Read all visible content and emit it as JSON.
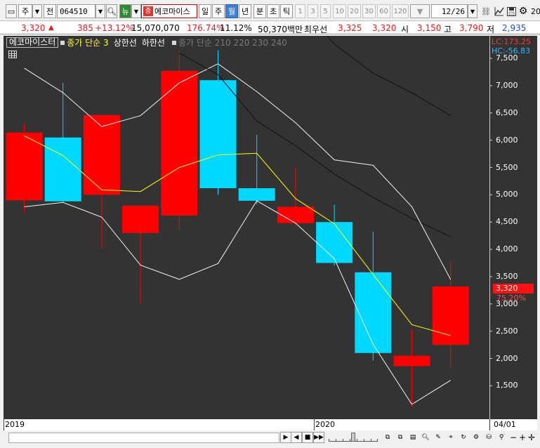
{
  "toolbar": {
    "period_main": "주",
    "jeon": "전",
    "code": "064510",
    "nyu": "뉴",
    "badge": "증",
    "stock_name": "에코마이스",
    "periods": [
      "일",
      "주",
      "월",
      "년",
      "분",
      "초",
      "틱"
    ],
    "selected_period": "월",
    "numbers": [
      "1",
      "3",
      "5",
      "10",
      "20",
      "30",
      "60",
      "120"
    ],
    "page": "12/26",
    "edge": "20"
  },
  "quote": {
    "price": "3,320",
    "change": "385",
    "change_pct": "+13.12%",
    "volume": "15,070,070",
    "vol_ratio": "176.74%",
    "turnover": "11.12%",
    "amount": "50,370백만",
    "best_ask_label": "최우선",
    "best_ask": "3,325",
    "best_bid": "3,320",
    "open_label": "시",
    "open": "3,150",
    "high_label": "고",
    "high": "3,790",
    "low_label": "저",
    "low": "2,935"
  },
  "legend": {
    "name": "에코마이스터",
    "ma": "종가 단순 3",
    "upper": "상한선",
    "lower": "하한선",
    "vol_ma": "종가 단순 210  220  230  240"
  },
  "axis": {
    "lc": "LC:173.25",
    "hc": "HC:-56.83",
    "current_price": "3,320",
    "current_pct": "75.20%"
  },
  "chart_data": {
    "type": "candlestick",
    "x": [
      "2019-01",
      "2019-02",
      "2019-03",
      "2019-04",
      "2019-05",
      "2019-06",
      "2019-07",
      "2019-08",
      "2019-09",
      "2019-10",
      "2019-11",
      "2019-12"
    ],
    "open": [
      4900,
      6050,
      5000,
      4300,
      4620,
      7100,
      5120,
      4480,
      4500,
      3580,
      1860,
      2250
    ],
    "high": [
      6300,
      7050,
      6420,
      4800,
      7650,
      7650,
      6100,
      5500,
      4820,
      4320,
      2530,
      3790
    ],
    "low": [
      4680,
      4850,
      4020,
      3000,
      4350,
      5000,
      4830,
      4430,
      3700,
      1960,
      1120,
      1830
    ],
    "close": [
      6140,
      4880,
      6460,
      4800,
      7270,
      5120,
      4890,
      4780,
      3750,
      2100,
      2050,
      3320
    ],
    "up_color": "#ff0000",
    "down_color": "#00d8ff",
    "ma3": [
      6080,
      5720,
      5090,
      5060,
      5500,
      5730,
      5760,
      4930,
      4470,
      3540,
      2620,
      2420
    ],
    "upper_band": [
      7320,
      6870,
      6250,
      6450,
      7050,
      7400,
      6890,
      6320,
      5640,
      5540,
      4780,
      3450
    ],
    "lower_band": [
      4780,
      4860,
      4590,
      3710,
      3450,
      3740,
      4890,
      4480,
      3830,
      2260,
      1160,
      1600
    ],
    "long_ma_a": [
      null,
      null,
      null,
      null,
      null,
      null,
      null,
      null,
      7760,
      7230,
      6870,
      6450
    ],
    "long_ma_b": [
      null,
      null,
      null,
      null,
      null,
      null,
      6350,
      5900,
      5380,
      4950,
      4570,
      4230
    ],
    "ylim": [
      900,
      7900
    ],
    "y_ticks": [
      1500,
      2000,
      2500,
      3000,
      3500,
      4000,
      4500,
      5000,
      5500,
      6000,
      6500,
      7000,
      7500
    ],
    "y_tick_labels": [
      "1,500",
      "2,000",
      "2,500",
      "3,000",
      "3,500",
      "4,000",
      "4,500",
      "5,000",
      "5,500",
      "6,000",
      "6,500",
      "7,000",
      "7,500"
    ],
    "x_labels": [
      "2019",
      "2020",
      "04/01"
    ]
  }
}
